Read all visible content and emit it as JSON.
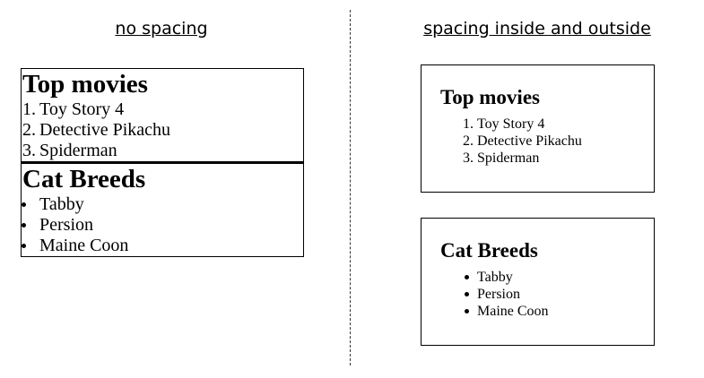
{
  "captions": {
    "left": "no spacing",
    "right": "spacing inside and outside"
  },
  "movies": {
    "title": "Top movies",
    "items": [
      {
        "number": "1.",
        "label": "Toy Story 4"
      },
      {
        "number": "2.",
        "label": "Detective Pikachu"
      },
      {
        "number": "3.",
        "label": "Spiderman"
      }
    ]
  },
  "cats": {
    "title": "Cat Breeds",
    "items": [
      "Tabby",
      "Persion",
      "Maine Coon"
    ]
  }
}
